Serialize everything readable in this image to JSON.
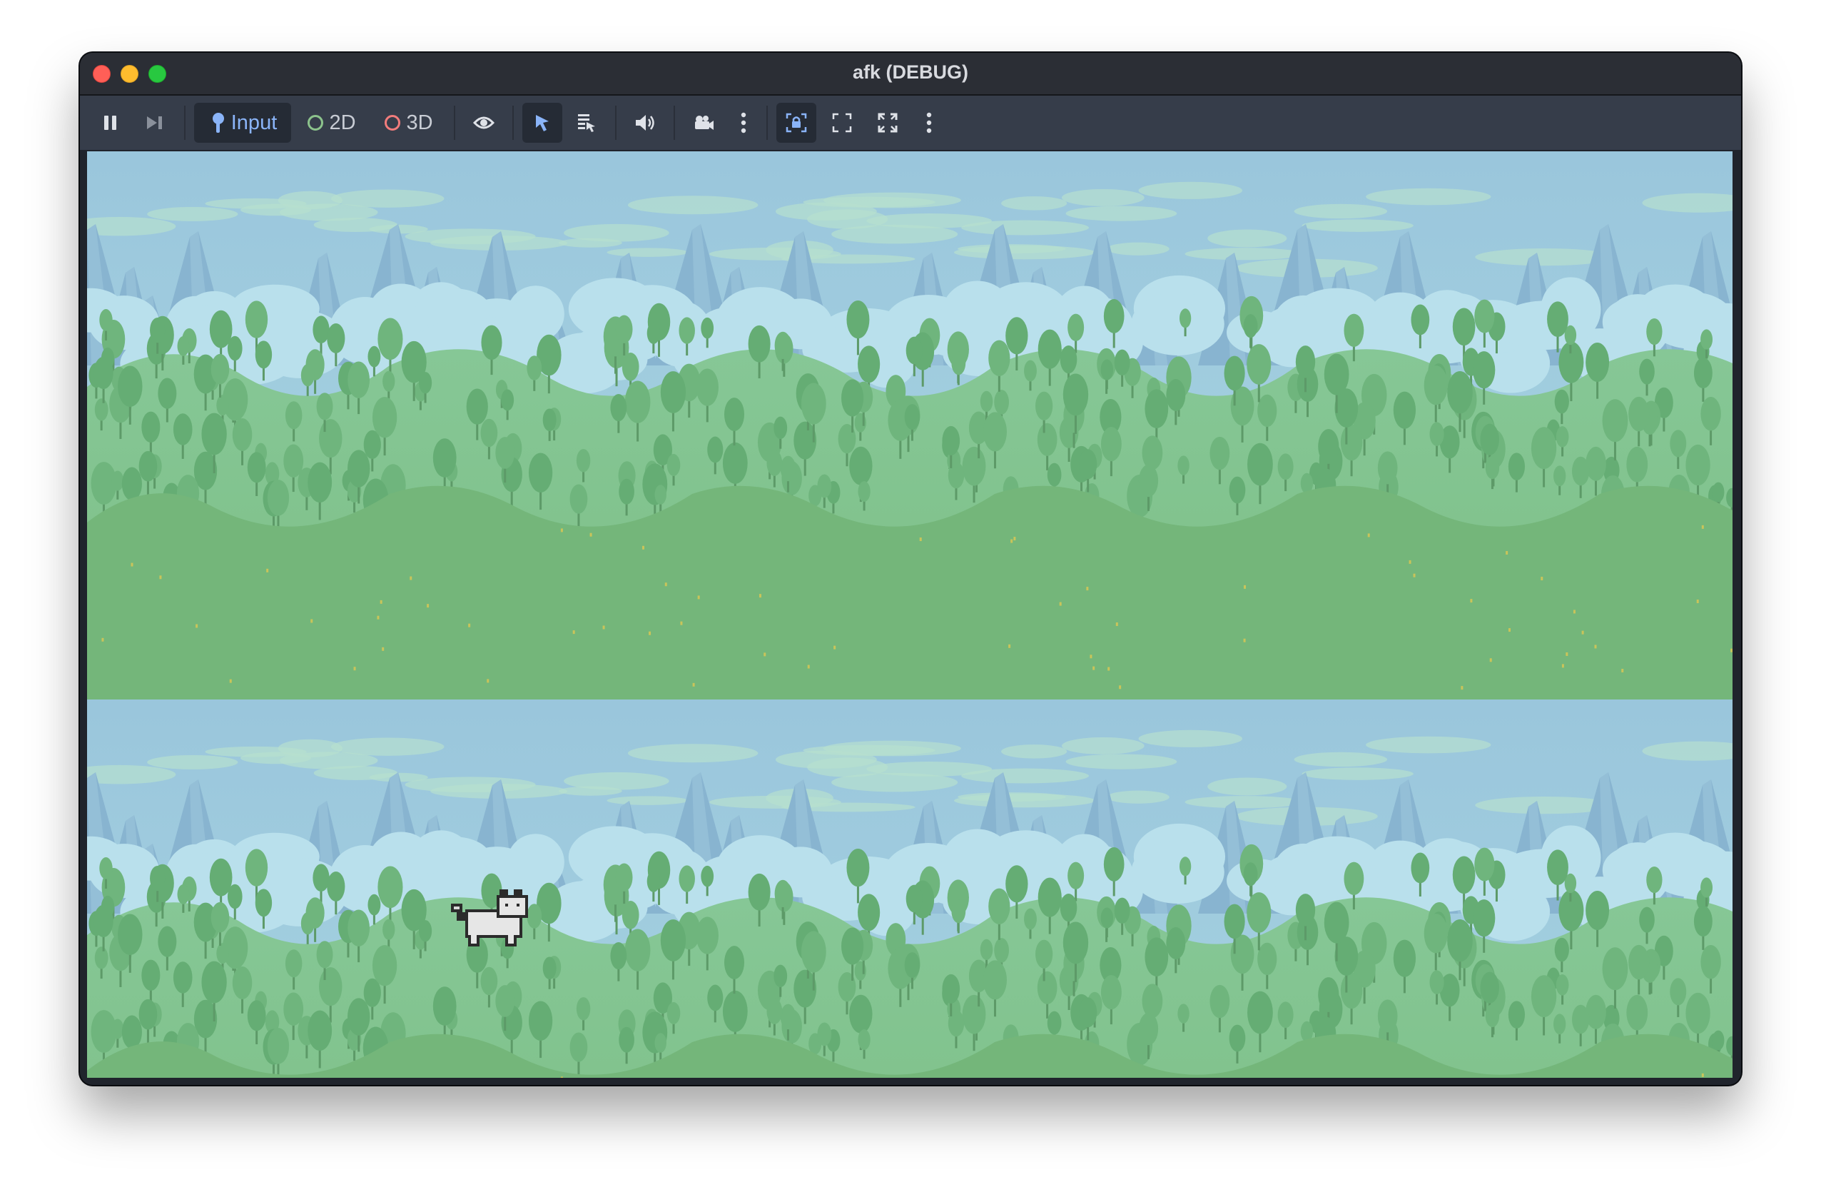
{
  "window": {
    "title": "afk (DEBUG)"
  },
  "toolbar": {
    "pause_icon": "pause-icon",
    "next_frame_icon": "next-frame-icon",
    "input_label": "Input",
    "mode_2d_label": "2D",
    "mode_3d_label": "3D",
    "visibility_icon": "eye-icon",
    "select_icon": "cursor-icon",
    "list_select_icon": "list-select-icon",
    "audio_icon": "speaker-icon",
    "camera_icon": "camera-icon",
    "more_icon": "more-vertical-icon",
    "embed_icon": "lock-frame-icon",
    "fullscreen_icon": "fullscreen-icon",
    "maximize_icon": "maximize-icon"
  },
  "colors": {
    "sky": "#9cc8dc",
    "mountain": "#88b4d0",
    "frost": "#b9e0ec",
    "forest": "#7cbf88",
    "hill": "#74b67a",
    "accent": "#8ab4f8"
  },
  "game": {
    "character": "pixel-cat-sprite"
  }
}
